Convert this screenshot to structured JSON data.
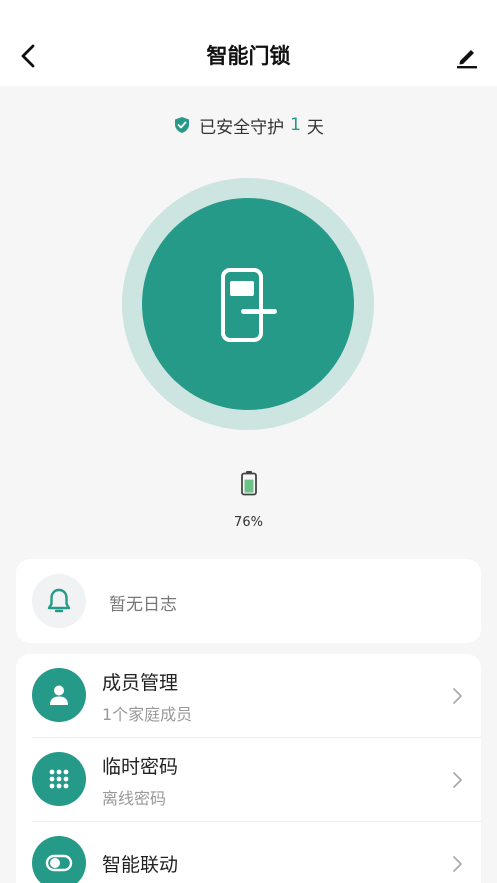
{
  "header": {
    "title": "智能门锁",
    "back_icon": "chevron-left-icon",
    "edit_icon": "edit-pencil-icon"
  },
  "guard": {
    "prefix": "已安全守护",
    "days": "1",
    "suffix": "天"
  },
  "battery": {
    "percent_text": "76%",
    "level": 0.76
  },
  "log": {
    "empty_text": "暂无日志"
  },
  "menu": {
    "items": [
      {
        "title": "成员管理",
        "subtitle": "1个家庭成员",
        "icon": "person-icon"
      },
      {
        "title": "临时密码",
        "subtitle": "离线密码",
        "icon": "keypad-icon"
      },
      {
        "title": "智能联动",
        "subtitle": "",
        "icon": "toggle-icon"
      }
    ]
  },
  "colors": {
    "accent": "#259a88",
    "accent_light": "#cde5e1",
    "background": "#f6f6f6"
  }
}
